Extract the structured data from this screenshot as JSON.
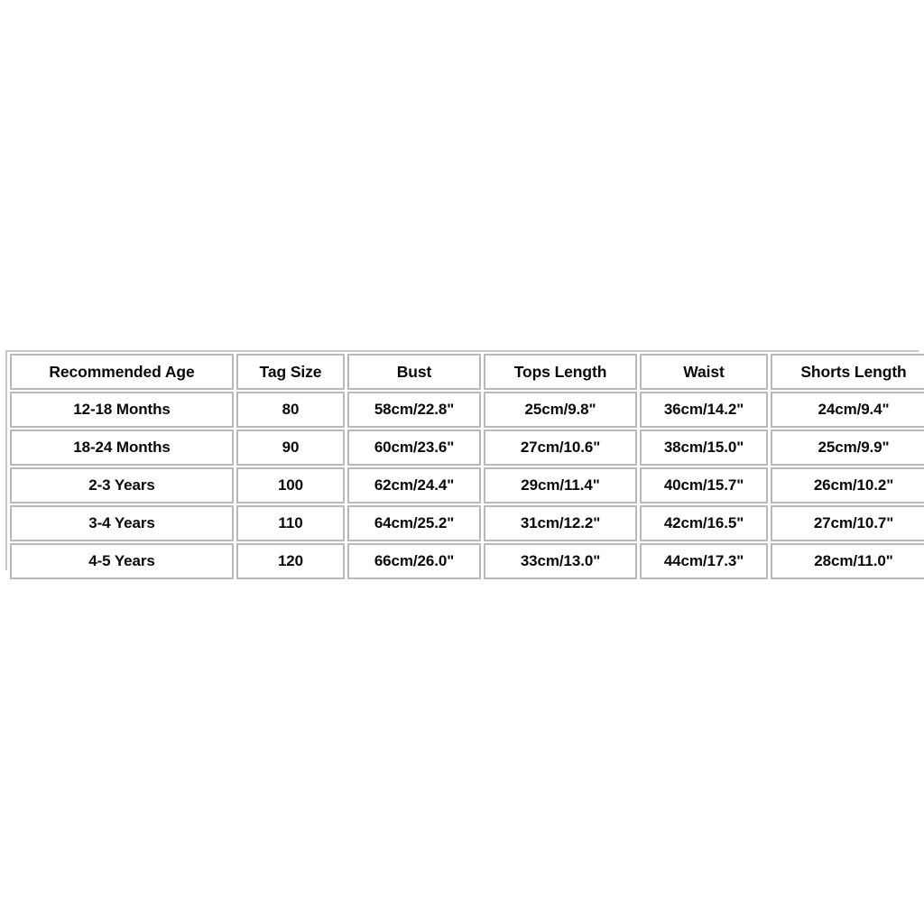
{
  "table": {
    "columns": [
      "Recommended Age",
      "Tag Size",
      "Bust",
      "Tops Length",
      "Waist",
      "Shorts Length"
    ],
    "rows": [
      {
        "age": "12-18 Months",
        "tag_size": "80",
        "bust": "58cm/22.8\"",
        "tops_length": "25cm/9.8\"",
        "waist": "36cm/14.2\"",
        "shorts_length": "24cm/9.4\""
      },
      {
        "age": "18-24 Months",
        "tag_size": "90",
        "bust": "60cm/23.6\"",
        "tops_length": "27cm/10.6\"",
        "waist": "38cm/15.0\"",
        "shorts_length": "25cm/9.9\""
      },
      {
        "age": "2-3 Years",
        "tag_size": "100",
        "bust": "62cm/24.4\"",
        "tops_length": "29cm/11.4\"",
        "waist": "40cm/15.7\"",
        "shorts_length": "26cm/10.2\""
      },
      {
        "age": "3-4 Years",
        "tag_size": "110",
        "bust": "64cm/25.2\"",
        "tops_length": "31cm/12.2\"",
        "waist": "42cm/16.5\"",
        "shorts_length": "27cm/10.7\""
      },
      {
        "age": "4-5 Years",
        "tag_size": "120",
        "bust": "66cm/26.0\"",
        "tops_length": "33cm/13.0\"",
        "waist": "44cm/17.3\"",
        "shorts_length": "28cm/11.0\""
      }
    ]
  },
  "colors": {
    "page_background": "#ffffff",
    "cell_background": "#ffffff",
    "cell_border": "#b9b9b9",
    "outer_border": "#c9c9c9",
    "text": "#0a0a0a"
  }
}
